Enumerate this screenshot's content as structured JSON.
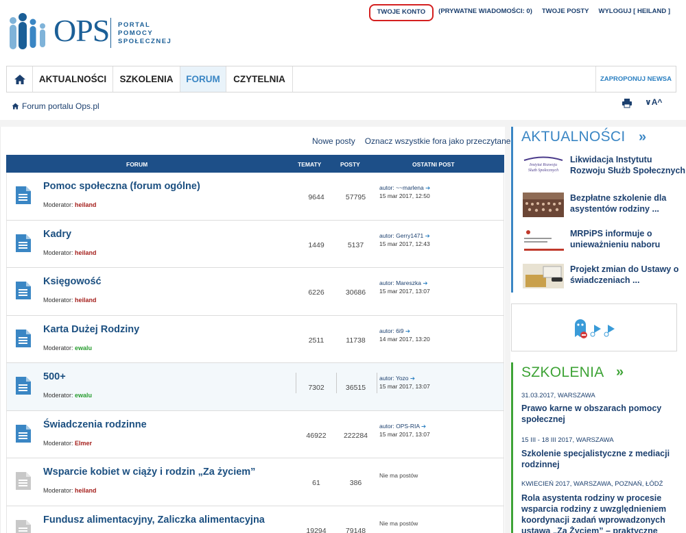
{
  "logo": {
    "brand": "OPS",
    "tag": [
      "PORTAL",
      "POMOCY",
      "SPOŁECZNEJ"
    ]
  },
  "top_links": {
    "account": "TWOJE KONTO",
    "messages": "(PRYWATNE WIADOMOŚCI: 0)",
    "posts": "TWOJE POSTY",
    "logout": "WYLOGUJ [ HEILAND ]"
  },
  "nav": {
    "home_icon": "home-icon",
    "items": [
      "AKTUALNOŚCI",
      "SZKOLENIA",
      "FORUM",
      "CZYTELNIA"
    ],
    "active": "FORUM",
    "propose": "ZAPROPONUJ NEWSA"
  },
  "breadcrumb": {
    "label": "Forum portalu Ops.pl"
  },
  "tools": {
    "font_size": "∨A^"
  },
  "forum": {
    "actions": [
      "Nowe posty",
      "Oznacz wszystkie fora jako przeczytane"
    ],
    "columns": {
      "forum": "FORUM",
      "topics": "TEMATY",
      "posts": "POSTY",
      "last": "OSTATNI POST"
    },
    "rows": [
      {
        "title": "Pomoc społeczna (forum ogólne)",
        "mod_label": "Moderator:",
        "moderator": "heiland",
        "topics": "9644",
        "posts": "57795",
        "last_author": "autor: ~~marlena",
        "last_date": "15 mar 2017, 12:50"
      },
      {
        "title": "Kadry",
        "mod_label": "Moderator:",
        "moderator": "heiland",
        "topics": "1449",
        "posts": "5137",
        "last_author": "autor: Gerry1471",
        "last_date": "15 mar 2017, 12:43"
      },
      {
        "title": "Księgowość",
        "mod_label": "Moderator:",
        "moderator": "heiland",
        "topics": "6226",
        "posts": "30686",
        "last_author": "autor: Mareszka",
        "last_date": "15 mar 2017, 13:07"
      },
      {
        "title": "Karta Dużej Rodziny",
        "mod_label": "Moderator:",
        "moderator": "ewalu",
        "topics": "2511",
        "posts": "11738",
        "last_author": "autor: 6i9",
        "last_date": "14 mar 2017, 13:20"
      },
      {
        "title": "500+",
        "mod_label": "Moderator:",
        "moderator": "ewalu",
        "topics": "7302",
        "posts": "36515",
        "last_author": "autor: Yozo",
        "last_date": "15 mar 2017, 13:07"
      },
      {
        "title": "Świadczenia rodzinne",
        "mod_label": "Moderator:",
        "moderator": "Elmer",
        "topics": "46922",
        "posts": "222284",
        "last_author": "autor: OPS-RIA",
        "last_date": "15 mar 2017, 13:07"
      },
      {
        "title": "Wsparcie kobiet w ciąży i rodzin „Za życiem”",
        "mod_label": "Moderator:",
        "moderator": "heiland",
        "topics": "61",
        "posts": "386",
        "no_posts": "Nie ma postów"
      },
      {
        "title": "Fundusz alimentacyjny, Zaliczka alimentacyjna",
        "topics": "19294",
        "posts": "79148",
        "no_posts": "Nie ma postów"
      }
    ]
  },
  "sidebar": {
    "news": {
      "heading": "AKTUALNOŚCI",
      "chevron": "»",
      "thumb1_text": [
        "Instytut Rozwoju",
        "Służb Społecznych"
      ],
      "items": [
        "Likwidacja Instytutu Rozwoju Służb Społecznych",
        "Bezpłatne szkolenie dla asystentów rodziny ...",
        "MRPiPS informuje o unieważnieniu naboru",
        "Projekt zmian do Ustawy o świadczeniach ..."
      ]
    },
    "trainings": {
      "heading": "SZKOLENIA",
      "chevron": "»",
      "items": [
        {
          "meta": "31.03.2017, WARSZAWA",
          "title": "Prawo karne w obszarach pomocy społecznej"
        },
        {
          "meta": "15 III - 18 III 2017, WARSZAWA",
          "title": "Szkolenie specjalistyczne z mediacji rodzinnej"
        },
        {
          "meta": "KWIECIEŃ 2017, WARSZAWA, POZNAŃ, ŁÓDŹ",
          "title": "Rola asystenta rodziny w procesie wsparcia rodziny z uwzględnieniem koordynacji zadań wprowadzonych ustawą „Za Życiem” – praktyczne"
        }
      ]
    }
  }
}
